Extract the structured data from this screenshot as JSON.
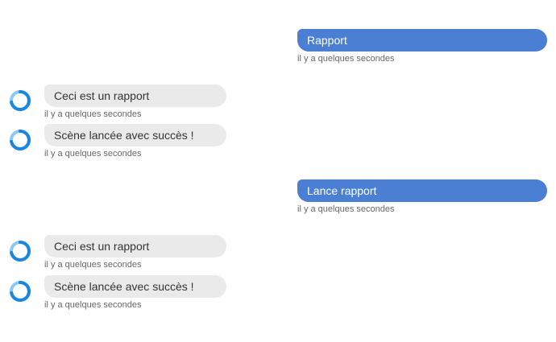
{
  "conversation": {
    "messages": [
      {
        "sender": "user",
        "text": "Rapport",
        "time": "il y a quelques secondes"
      },
      {
        "sender": "bot",
        "text": "Ceci est un rapport",
        "time": "il y a quelques secondes"
      },
      {
        "sender": "bot",
        "text": "Scène lancée avec succès !",
        "time": "il y a quelques secondes"
      },
      {
        "sender": "user",
        "text": "Lance rapport",
        "time": "il y a quelques secondes"
      },
      {
        "sender": "bot",
        "text": "Ceci est un rapport",
        "time": "il y a quelques secondes"
      },
      {
        "sender": "bot",
        "text": "Scène lancée avec succès !",
        "time": "il y a quelques secondes"
      }
    ]
  },
  "colors": {
    "user_bubble": "#4a7fd4",
    "bot_bubble": "#eaeaea",
    "avatar_ring": "#1a86e0"
  },
  "icons": {
    "bot_avatar": "bot-ring-icon"
  }
}
